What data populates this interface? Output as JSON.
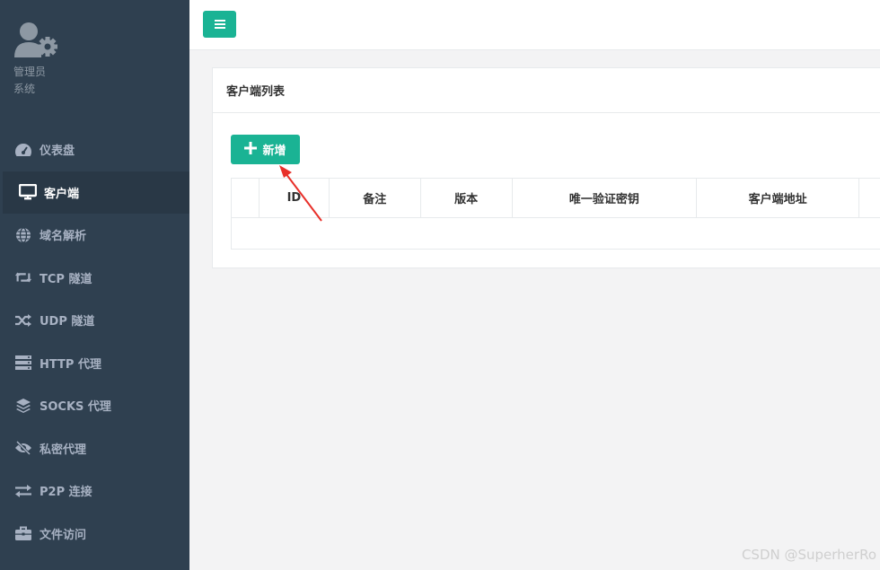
{
  "sidebar": {
    "profile": {
      "line1": "管理员",
      "line2": "系统"
    },
    "items": [
      {
        "label": "仪表盘",
        "icon": "dashboard-icon"
      },
      {
        "label": "客户端",
        "icon": "monitor-icon",
        "active": true
      },
      {
        "label": "域名解析",
        "icon": "globe-icon"
      },
      {
        "label": "TCP 隧道",
        "icon": "retweet-icon"
      },
      {
        "label": "UDP 隧道",
        "icon": "random-icon"
      },
      {
        "label": "HTTP 代理",
        "icon": "server-icon"
      },
      {
        "label": "SOCKS 代理",
        "icon": "layers-icon"
      },
      {
        "label": "私密代理",
        "icon": "eye-slash-icon"
      },
      {
        "label": "P2P 连接",
        "icon": "exchange-icon"
      },
      {
        "label": "文件访问",
        "icon": "briefcase-icon"
      }
    ]
  },
  "main": {
    "panel_title": "客户端列表",
    "add_button": "新增",
    "table_headers": [
      "",
      "ID",
      "备注",
      "版本",
      "唯一验证密钥",
      "客户端地址"
    ]
  },
  "watermark": "CSDN @SuperherRo",
  "colors": {
    "sidebar": "#2f4050",
    "accent": "#1ab394",
    "annotation": "#e8302a"
  }
}
